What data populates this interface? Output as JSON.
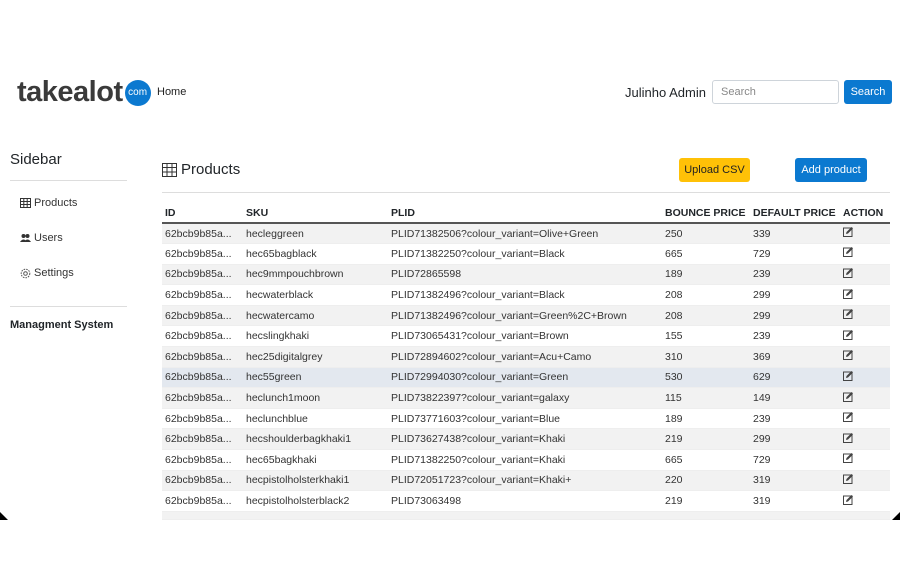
{
  "header": {
    "logo_text": "takealot",
    "logo_badge": "com",
    "home": "Home",
    "user": "Julinho Admin",
    "search_placeholder": "Search",
    "search_button": "Search"
  },
  "sidebar": {
    "title": "Sidebar",
    "items": [
      {
        "label": "Products",
        "icon": "table-icon"
      },
      {
        "label": "Users",
        "icon": "users-icon"
      },
      {
        "label": "Settings",
        "icon": "gear-icon"
      }
    ],
    "footer": "Managment System"
  },
  "main": {
    "title": "Products",
    "upload_button": "Upload CSV",
    "add_button": "Add product",
    "columns": [
      "ID",
      "SKU",
      "PLID",
      "BOUNCE PRICE",
      "DEFAULT PRICE",
      "ACTION"
    ],
    "rows": [
      [
        "62bcb9b85a...",
        "hecleggreen",
        "PLID71382506?colour_variant=Olive+Green",
        "250",
        "339"
      ],
      [
        "62bcb9b85a...",
        "hec65bagblack",
        "PLID71382250?colour_variant=Black",
        "665",
        "729"
      ],
      [
        "62bcb9b85a...",
        "hec9mmpouchbrown",
        "PLID72865598",
        "189",
        "239"
      ],
      [
        "62bcb9b85a...",
        "hecwaterblack",
        "PLID71382496?colour_variant=Black",
        "208",
        "299"
      ],
      [
        "62bcb9b85a...",
        "hecwatercamo",
        "PLID71382496?colour_variant=Green%2C+Brown",
        "208",
        "299"
      ],
      [
        "62bcb9b85a...",
        "hecslingkhaki",
        "PLID73065431?colour_variant=Brown",
        "155",
        "239"
      ],
      [
        "62bcb9b85a...",
        "hec25digitalgrey",
        "PLID72894602?colour_variant=Acu+Camo",
        "310",
        "369"
      ],
      [
        "62bcb9b85a...",
        "hec55green",
        "PLID72994030?colour_variant=Green",
        "530",
        "629"
      ],
      [
        "62bcb9b85a...",
        "heclunch1moon",
        "PLID73822397?colour_variant=galaxy",
        "115",
        "149"
      ],
      [
        "62bcb9b85a...",
        "heclunchblue",
        "PLID73771603?colour_variant=Blue",
        "189",
        "239"
      ],
      [
        "62bcb9b85a...",
        "hecshoulderbagkhaki1",
        "PLID73627438?colour_variant=Khaki",
        "219",
        "299"
      ],
      [
        "62bcb9b85a...",
        "hec65bagkhaki",
        "PLID71382250?colour_variant=Khaki",
        "665",
        "729"
      ],
      [
        "62bcb9b85a...",
        "hecpistolholsterkhaki1",
        "PLID72051723?colour_variant=Khaki+",
        "220",
        "319"
      ],
      [
        "62bcb9b85a...",
        "hecpistolholsterblack2",
        "PLID73063498",
        "219",
        "319"
      ]
    ],
    "highlighted_row": 7,
    "action_icon": "edit-icon"
  },
  "colors": {
    "primary": "#0b79d0",
    "warning": "#ffc107",
    "highlight": "#e3e8ef"
  }
}
